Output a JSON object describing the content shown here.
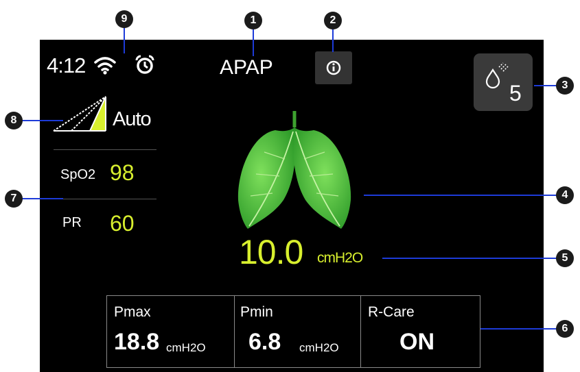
{
  "status": {
    "time": "4:12",
    "wifi_icon": "wifi-icon",
    "alarm_icon": "alarm-clock-icon"
  },
  "header": {
    "mode": "APAP",
    "info_icon": "info-icon"
  },
  "humidifier": {
    "icon": "water-drop-icon",
    "level": "5"
  },
  "ramp": {
    "icon": "ramp-icon",
    "label": "Auto"
  },
  "vitals": {
    "spo2_label": "SpO2",
    "spo2_value": "98",
    "pr_label": "PR",
    "pr_value": "60"
  },
  "lungs": {
    "icon": "lungs-leaves-icon"
  },
  "pressure": {
    "value": "10.0",
    "unit": "cmH2O"
  },
  "settings": {
    "pmax_label": "Pmax",
    "pmax_value": "18.8",
    "pmax_unit": "cmH2O",
    "pmin_label": "Pmin",
    "pmin_value": "6.8",
    "pmin_unit": "cmH2O",
    "rcare_label": "R-Care",
    "rcare_value": "ON"
  },
  "callouts": [
    "1",
    "2",
    "3",
    "4",
    "5",
    "6",
    "7",
    "8",
    "9"
  ],
  "colors": {
    "accent": "#d8ef2e",
    "background": "#000000",
    "callout_line": "#1d3bd8"
  }
}
